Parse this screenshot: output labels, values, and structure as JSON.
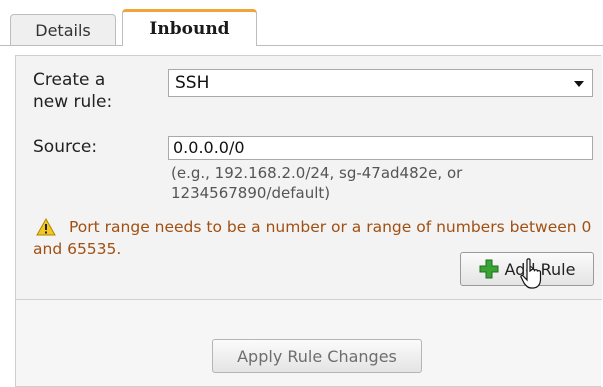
{
  "tabs": [
    {
      "label": "Details"
    },
    {
      "label": "Inbound"
    }
  ],
  "form": {
    "rule_label": "Create a new rule:",
    "rule_value": "SSH",
    "source_label": "Source:",
    "source_value": "0.0.0.0/0",
    "source_hint": "(e.g., 192.168.2.0/24, sg-47ad482e, or 1234567890/default)"
  },
  "warning": {
    "text": "Port range needs to be a number or a range of numbers between 0 and 65535.",
    "color": "#a14f12"
  },
  "buttons": {
    "add_rule": "Add Rule",
    "apply_changes": "Apply Rule Changes"
  },
  "colors": {
    "active_tab_accent": "#f0a43a",
    "add_icon": "#3aa335"
  }
}
